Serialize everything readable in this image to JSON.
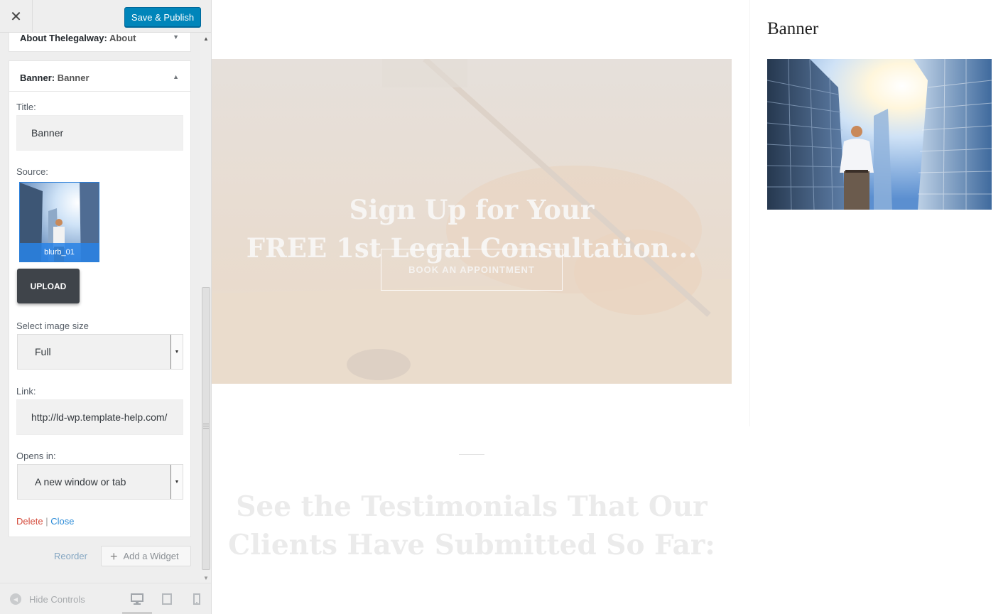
{
  "topbar": {
    "close_icon": "close-icon",
    "save_label": "Save & Publish",
    "accent": "#0085ba"
  },
  "widgets": {
    "about": {
      "type": "About Thelegalway:",
      "title": "About"
    },
    "banner": {
      "type": "Banner:",
      "title": "Banner"
    }
  },
  "form": {
    "title_label": "Title:",
    "title_value": "Banner",
    "source_label": "Source:",
    "image_name": "blurb_01",
    "upload_label": "UPLOAD",
    "size_label": "Select image size",
    "size_value": "Full",
    "link_label": "Link:",
    "link_value": "http://ld-wp.template-help.com/",
    "opens_label": "Opens in:",
    "opens_value": "A new window or tab",
    "delete_label": "Delete",
    "separator": "|",
    "close_label": "Close"
  },
  "actions": {
    "reorder_label": "Reorder",
    "add_widget_label": "Add a Widget"
  },
  "footer": {
    "hide_controls_label": "Hide Controls",
    "devices": [
      "desktop-icon",
      "tablet-icon",
      "mobile-icon"
    ]
  },
  "preview": {
    "hero_line1": "Sign Up for Your",
    "hero_line2": "FREE 1st Legal Consultation...",
    "hero_button": "BOOK AN APPOINTMENT",
    "testimonials_line1": "See the Testimonials That Our",
    "testimonials_line2": "Clients Have Submitted So Far:",
    "sidebar_title": "Banner"
  }
}
